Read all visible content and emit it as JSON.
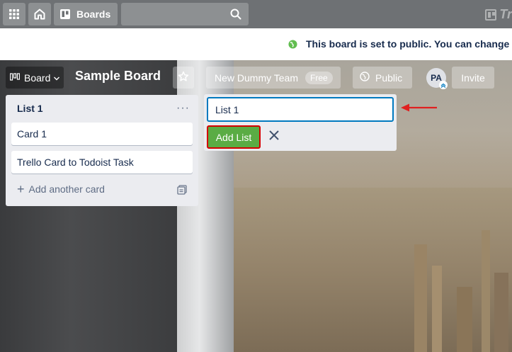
{
  "topbar": {
    "apps_icon": "grid-icon",
    "home_icon": "home-icon",
    "boards_label": "Boards",
    "search_icon": "search-icon",
    "logo_text": "Tre"
  },
  "banner": {
    "icon": "globe-icon",
    "text": "This board is set to public. You can change"
  },
  "board_header": {
    "switcher_label": "Board",
    "title": "Sample Board",
    "team_name": "New Dummy Team",
    "team_badge": "Free",
    "visibility_label": "Public",
    "avatar_initials": "PA",
    "invite_label": "Invite"
  },
  "list": {
    "title": "List 1",
    "menu_glyph": "···",
    "cards": [
      {
        "title": "Card 1"
      },
      {
        "title": "Trello Card to Todoist Task"
      }
    ],
    "add_card_label": "Add another card"
  },
  "composer": {
    "input_value": "List 1",
    "add_button_label": "Add List"
  },
  "colors": {
    "accent_blue": "#0079bf",
    "add_green": "#5aac44",
    "highlight_red": "#d40000"
  }
}
